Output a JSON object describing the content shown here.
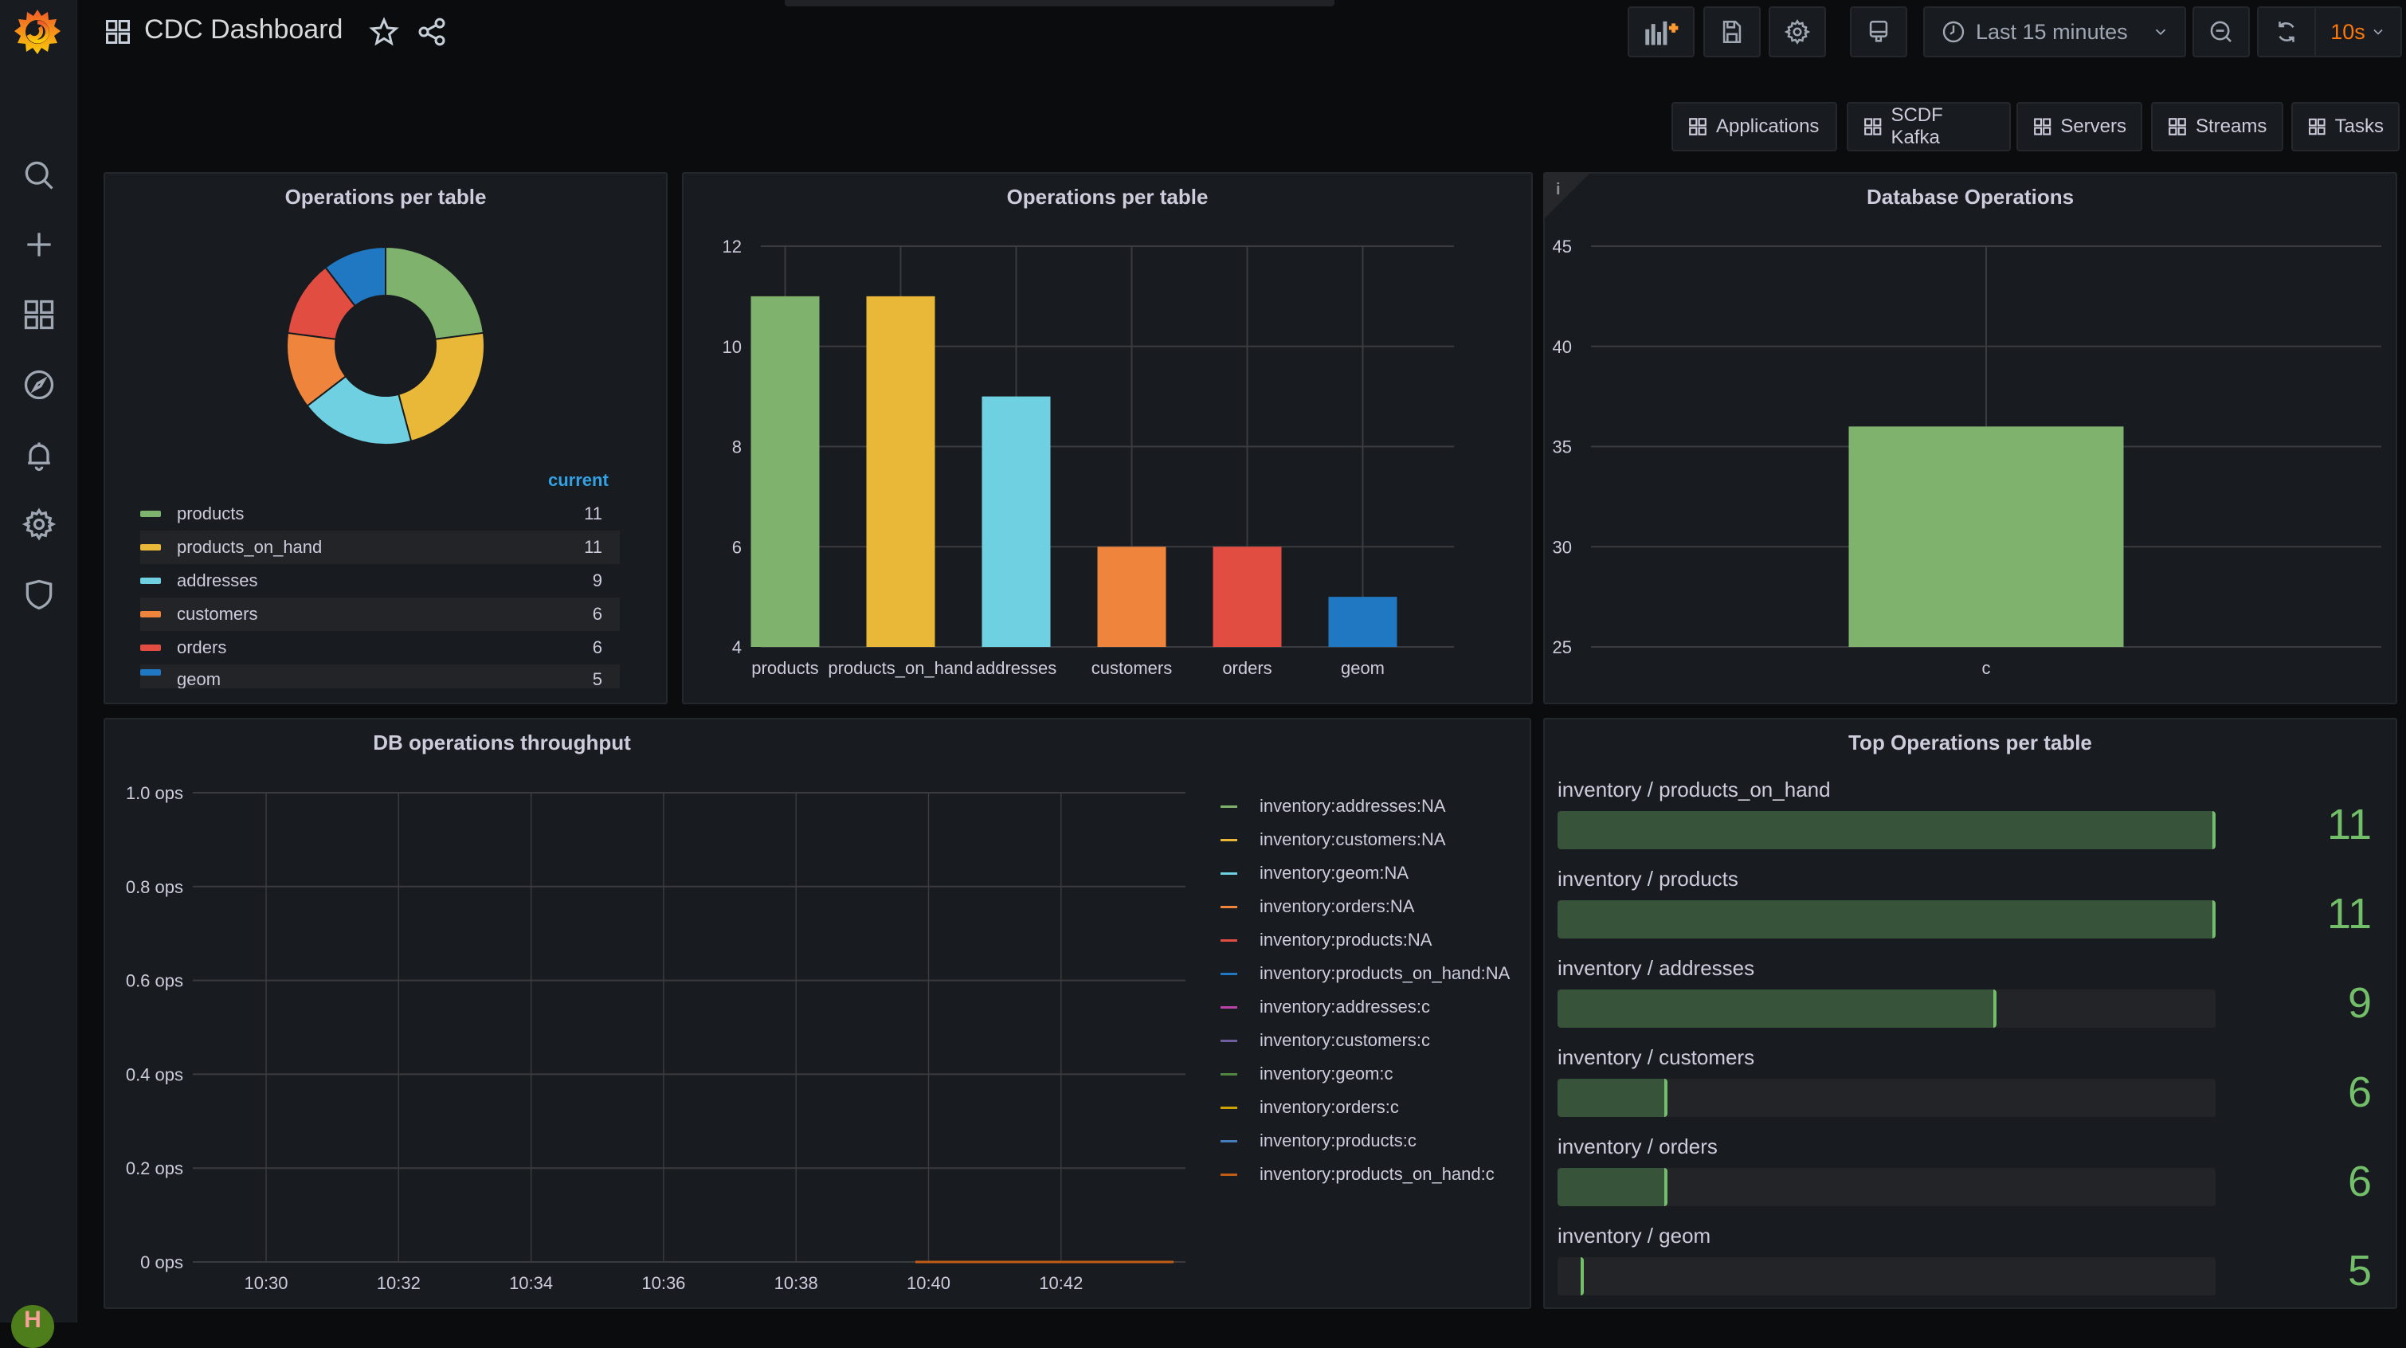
{
  "app": {
    "title": "CDC Dashboard",
    "brand_color": "#f46800"
  },
  "sidebar": {
    "items": [
      {
        "name": "search",
        "icon": "search-icon"
      },
      {
        "name": "create",
        "icon": "plus-icon"
      },
      {
        "name": "dashboards",
        "icon": "dashboards-grid-icon"
      },
      {
        "name": "explore",
        "icon": "compass-icon"
      },
      {
        "name": "alerting",
        "icon": "bell-icon"
      },
      {
        "name": "configuration",
        "icon": "gear-icon"
      },
      {
        "name": "server-admin",
        "icon": "shield-icon"
      }
    ],
    "user_initial": "H"
  },
  "toolbar": {
    "add_panel": "add-panel-icon",
    "save": "save-icon",
    "settings": "gear-icon",
    "tv_mode": "monitor-icon",
    "time_range": "Last 15 minutes",
    "zoom_out": "zoom-out-icon",
    "refresh": "refresh-icon",
    "refresh_interval": "10s"
  },
  "dashboard_links": [
    "Applications",
    "SCDF Kafka",
    "Servers",
    "Streams",
    "Tasks"
  ],
  "panels": {
    "pie": {
      "title": "Operations per table",
      "legend_header": "current",
      "items": [
        {
          "label": "products",
          "value": "11",
          "color": "#7eb26d"
        },
        {
          "label": "products_on_hand",
          "value": "11",
          "color": "#eab839"
        },
        {
          "label": "addresses",
          "value": "9",
          "color": "#6ed0e0"
        },
        {
          "label": "customers",
          "value": "6",
          "color": "#ef843c"
        },
        {
          "label": "orders",
          "value": "6",
          "color": "#e24d42"
        },
        {
          "label": "geom",
          "value": "5",
          "color": "#1f78c1"
        }
      ]
    },
    "bar": {
      "title": "Operations per table"
    },
    "db_ops": {
      "title": "Database Operations",
      "info": "i"
    },
    "throughput": {
      "title": "DB operations throughput"
    },
    "top_ops": {
      "title": "Top Operations per table",
      "min": 5,
      "max": 11,
      "items": [
        {
          "label": "inventory / products_on_hand",
          "value": 11
        },
        {
          "label": "inventory / products",
          "value": 11
        },
        {
          "label": "inventory / addresses",
          "value": 9
        },
        {
          "label": "inventory / customers",
          "value": 6
        },
        {
          "label": "inventory / orders",
          "value": 6
        },
        {
          "label": "inventory / geom",
          "value": 5
        }
      ]
    }
  },
  "chart_data": [
    {
      "type": "pie",
      "title": "Operations per table",
      "categories": [
        "products",
        "products_on_hand",
        "addresses",
        "customers",
        "orders",
        "geom"
      ],
      "values": [
        11,
        11,
        9,
        6,
        6,
        5
      ],
      "colors": [
        "#7eb26d",
        "#eab839",
        "#6ed0e0",
        "#ef843c",
        "#e24d42",
        "#1f78c1"
      ],
      "donut": true,
      "legend": "bottom"
    },
    {
      "type": "bar",
      "title": "Operations per table",
      "categories": [
        "products",
        "products_on_hand",
        "addresses",
        "customers",
        "orders",
        "geom"
      ],
      "values": [
        11,
        11,
        9,
        6,
        6,
        5
      ],
      "colors": [
        "#7eb26d",
        "#eab839",
        "#6ed0e0",
        "#ef843c",
        "#e24d42",
        "#1f78c1"
      ],
      "yticks": [
        "4",
        "6",
        "8",
        "10",
        "12"
      ],
      "ylim": [
        4,
        12
      ],
      "grid": true
    },
    {
      "type": "bar",
      "title": "Database Operations",
      "categories": [
        "c"
      ],
      "values": [
        36
      ],
      "colors": [
        "#7eb26d"
      ],
      "yticks": [
        "25",
        "30",
        "35",
        "40",
        "45"
      ],
      "ylim": [
        25,
        45
      ],
      "grid": true
    },
    {
      "type": "line",
      "title": "DB operations throughput",
      "ylabel": "",
      "yticks": [
        "0 ops",
        "0.2 ops",
        "0.4 ops",
        "0.6 ops",
        "0.8 ops",
        "1.0 ops"
      ],
      "ylim": [
        0,
        1
      ],
      "xticks": [
        "10:30",
        "10:32",
        "10:34",
        "10:36",
        "10:38",
        "10:40",
        "10:42"
      ],
      "xlim_minutes": [
        10.48,
        10.73
      ],
      "grid": true,
      "legend": "right",
      "series": [
        {
          "name": "inventory:addresses:NA",
          "color": "#7eb26d",
          "points": []
        },
        {
          "name": "inventory:customers:NA",
          "color": "#eab839",
          "points": []
        },
        {
          "name": "inventory:geom:NA",
          "color": "#6ed0e0",
          "points": []
        },
        {
          "name": "inventory:orders:NA",
          "color": "#ef843c",
          "points": []
        },
        {
          "name": "inventory:products:NA",
          "color": "#e24d42",
          "points": []
        },
        {
          "name": "inventory:products_on_hand:NA",
          "color": "#1f78c1",
          "points": []
        },
        {
          "name": "inventory:addresses:c",
          "color": "#ba43a9",
          "points": []
        },
        {
          "name": "inventory:customers:c",
          "color": "#705da0",
          "points": []
        },
        {
          "name": "inventory:geom:c",
          "color": "#508642",
          "points": []
        },
        {
          "name": "inventory:orders:c",
          "color": "#cca300",
          "points": []
        },
        {
          "name": "inventory:products:c",
          "color": "#447ebc",
          "points": []
        },
        {
          "name": "inventory:products_on_hand:c",
          "color": "#c15c17",
          "points": [
            [
              "10:39.8",
              0
            ],
            [
              "10:43.7",
              0
            ]
          ]
        }
      ]
    },
    {
      "type": "bar",
      "title": "Top Operations per table",
      "orientation": "horizontal",
      "categories": [
        "inventory / products_on_hand",
        "inventory / products",
        "inventory / addresses",
        "inventory / customers",
        "inventory / orders",
        "inventory / geom"
      ],
      "values": [
        11,
        11,
        9,
        6,
        6,
        5
      ],
      "xlim": [
        5,
        11
      ]
    }
  ]
}
